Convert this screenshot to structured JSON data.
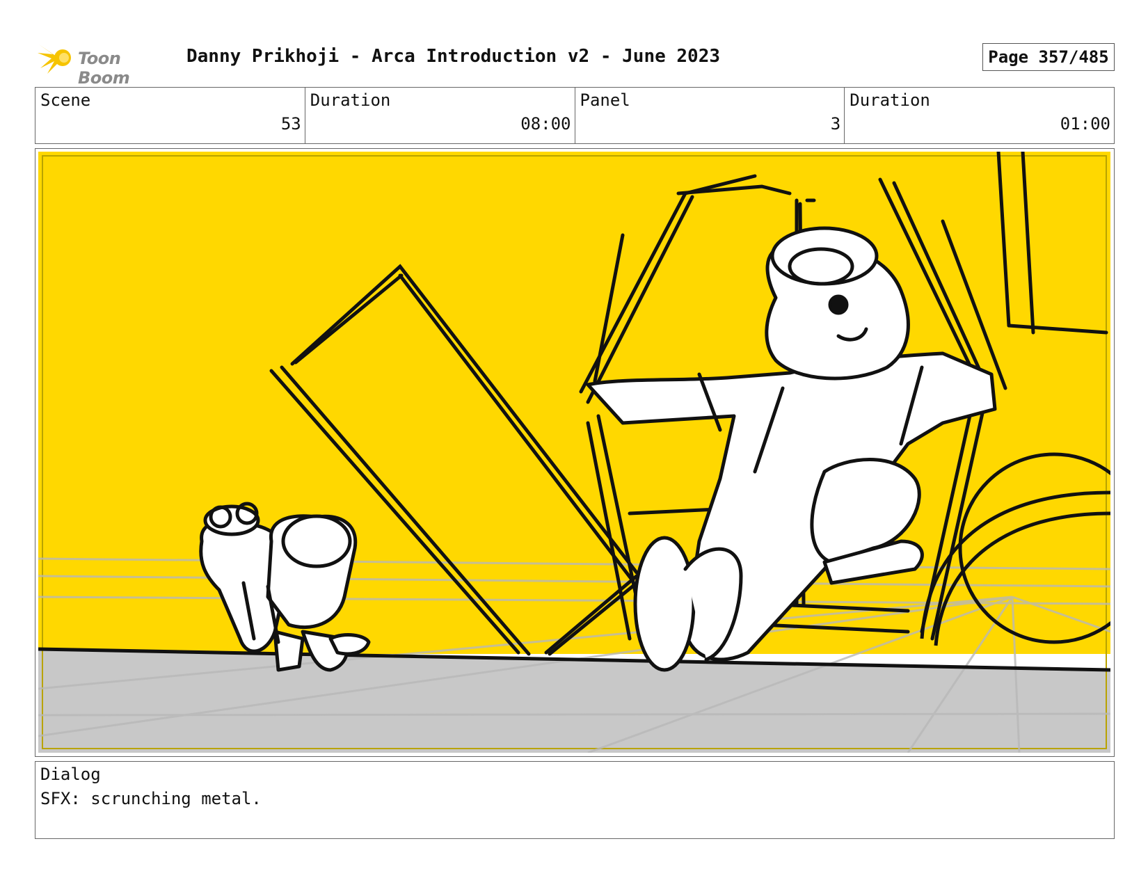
{
  "header": {
    "logo_text": "Toon Boom",
    "title": "Danny Prikhoji - Arca Introduction v2 - June 2023",
    "page": "Page 357/485"
  },
  "info": {
    "scene_label": "Scene",
    "scene_value": "53",
    "scene_duration_label": "Duration",
    "scene_duration_value": "08:00",
    "panel_label": "Panel",
    "panel_value": "3",
    "panel_duration_label": "Duration",
    "panel_duration_value": "01:00"
  },
  "panel_image": {
    "colors": {
      "wall": "#ffd800",
      "floor": "#c8c8c8",
      "ink": "#111111",
      "logo": "#f6c400"
    }
  },
  "dialog": {
    "label": "Dialog",
    "text": "SFX: scrunching metal."
  }
}
